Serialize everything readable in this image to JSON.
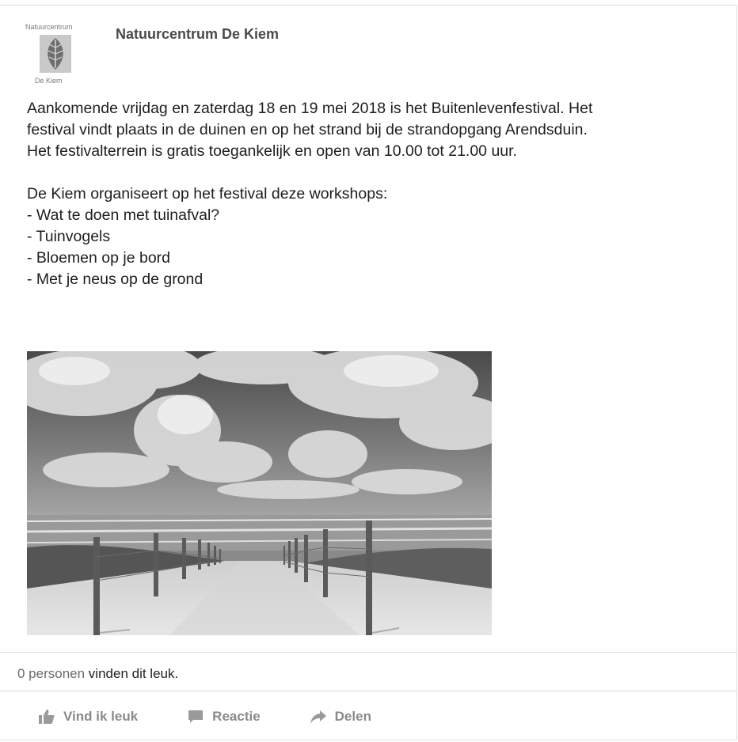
{
  "page": {
    "name": "Natuurcentrum De Kiem",
    "logo": {
      "top_text": "Natuurcentrum",
      "bottom_text": "De Kiem"
    }
  },
  "post": {
    "paragraph1": [
      "Aankomende vrijdag en zaterdag 18 en 19 mei 2018 is het Buitenlevenfestival. Het",
      "festival vindt plaats in de duinen en op het strand bij de strandopgang Arendsduin.",
      "Het festivalterrein is gratis toegankelijk en open van 10.00 tot 21.00 uur."
    ],
    "intro": "De Kiem organiseert op het festival deze workshops:",
    "workshops": [
      "- Wat te doen met tuinafval?",
      "- Tuinvogels",
      "- Bloemen op je bord",
      "- Met je neus op de grond"
    ],
    "photo_icon": "beach-dunes-photo"
  },
  "reactions": {
    "count": "0 personen",
    "suffix": " vinden dit leuk."
  },
  "actions": {
    "like_label": "Vind ik leuk",
    "comment_label": "Reactie",
    "share_label": "Delen",
    "like_icon": "thumbs-up-icon",
    "comment_icon": "speech-bubble-icon",
    "share_icon": "share-arrow-icon"
  }
}
